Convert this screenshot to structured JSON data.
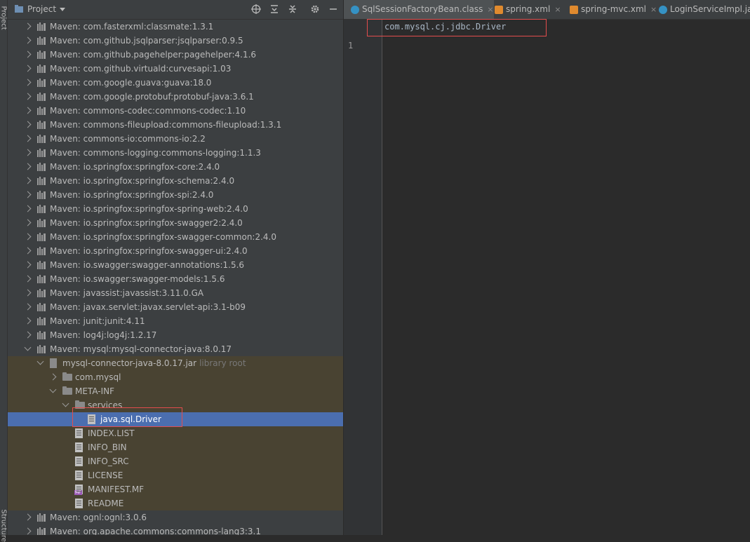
{
  "sidebar": {
    "project_label": "Project",
    "structure_label": "Structure"
  },
  "project_panel": {
    "title": "Project",
    "toolbar_icons": [
      "target-icon",
      "expand-all-icon",
      "collapse-all-icon",
      "gear-icon",
      "minimize-icon"
    ]
  },
  "tree": {
    "rows": [
      {
        "label": "Maven: com.fasterxml:classmate:1.3.1",
        "type": "lib",
        "chevron": "right"
      },
      {
        "label": "Maven: com.github.jsqlparser:jsqlparser:0.9.5",
        "type": "lib",
        "chevron": "right"
      },
      {
        "label": "Maven: com.github.pagehelper:pagehelper:4.1.6",
        "type": "lib",
        "chevron": "right"
      },
      {
        "label": "Maven: com.github.virtuald:curvesapi:1.03",
        "type": "lib",
        "chevron": "right"
      },
      {
        "label": "Maven: com.google.guava:guava:18.0",
        "type": "lib",
        "chevron": "right"
      },
      {
        "label": "Maven: com.google.protobuf:protobuf-java:3.6.1",
        "type": "lib",
        "chevron": "right"
      },
      {
        "label": "Maven: commons-codec:commons-codec:1.10",
        "type": "lib",
        "chevron": "right"
      },
      {
        "label": "Maven: commons-fileupload:commons-fileupload:1.3.1",
        "type": "lib",
        "chevron": "right"
      },
      {
        "label": "Maven: commons-io:commons-io:2.2",
        "type": "lib",
        "chevron": "right"
      },
      {
        "label": "Maven: commons-logging:commons-logging:1.1.3",
        "type": "lib",
        "chevron": "right"
      },
      {
        "label": "Maven: io.springfox:springfox-core:2.4.0",
        "type": "lib",
        "chevron": "right"
      },
      {
        "label": "Maven: io.springfox:springfox-schema:2.4.0",
        "type": "lib",
        "chevron": "right"
      },
      {
        "label": "Maven: io.springfox:springfox-spi:2.4.0",
        "type": "lib",
        "chevron": "right"
      },
      {
        "label": "Maven: io.springfox:springfox-spring-web:2.4.0",
        "type": "lib",
        "chevron": "right"
      },
      {
        "label": "Maven: io.springfox:springfox-swagger2:2.4.0",
        "type": "lib",
        "chevron": "right"
      },
      {
        "label": "Maven: io.springfox:springfox-swagger-common:2.4.0",
        "type": "lib",
        "chevron": "right"
      },
      {
        "label": "Maven: io.springfox:springfox-swagger-ui:2.4.0",
        "type": "lib",
        "chevron": "right"
      },
      {
        "label": "Maven: io.swagger:swagger-annotations:1.5.6",
        "type": "lib",
        "chevron": "right"
      },
      {
        "label": "Maven: io.swagger:swagger-models:1.5.6",
        "type": "lib",
        "chevron": "right"
      },
      {
        "label": "Maven: javassist:javassist:3.11.0.GA",
        "type": "lib",
        "chevron": "right"
      },
      {
        "label": "Maven: javax.servlet:javax.servlet-api:3.1-b09",
        "type": "lib",
        "chevron": "right"
      },
      {
        "label": "Maven: junit:junit:4.11",
        "type": "lib",
        "chevron": "right"
      },
      {
        "label": "Maven: log4j:log4j:1.2.17",
        "type": "lib",
        "chevron": "right"
      },
      {
        "label": "Maven: mysql:mysql-connector-java:8.0.17",
        "type": "lib",
        "chevron": "down"
      },
      {
        "label": "mysql-connector-java-8.0.17.jar",
        "hint": "library root",
        "type": "jar",
        "chevron": "down"
      },
      {
        "label": "com.mysql",
        "type": "folder",
        "chevron": "right"
      },
      {
        "label": "META-INF",
        "type": "folder",
        "chevron": "down"
      },
      {
        "label": "services",
        "type": "folder",
        "chevron": "down"
      },
      {
        "label": "java.sql.Driver",
        "type": "file",
        "chevron": "none"
      },
      {
        "label": "INDEX.LIST",
        "type": "file",
        "chevron": "none"
      },
      {
        "label": "INFO_BIN",
        "type": "file",
        "chevron": "none"
      },
      {
        "label": "INFO_SRC",
        "type": "file",
        "chevron": "none"
      },
      {
        "label": "LICENSE",
        "type": "file",
        "chevron": "none"
      },
      {
        "label": "MANIFEST.MF",
        "type": "mf",
        "chevron": "none"
      },
      {
        "label": "README",
        "type": "file",
        "chevron": "none"
      },
      {
        "label": "Maven: ognl:ognl:3.0.6",
        "type": "lib",
        "chevron": "right"
      },
      {
        "label": "Maven: org.apache.commons:commons-lang3:3.1",
        "type": "lib",
        "chevron": "right"
      }
    ]
  },
  "editor": {
    "tabs": [
      {
        "label": "SqlSessionFactoryBean.class",
        "icon": "class",
        "closable": true,
        "active": true
      },
      {
        "label": "spring.xml",
        "icon": "xml",
        "closable": true,
        "active": false
      },
      {
        "label": "spring-mvc.xml",
        "icon": "xml",
        "closable": true,
        "active": false
      },
      {
        "label": "LoginServiceImpl.java",
        "icon": "class",
        "closable": false,
        "active": false
      }
    ],
    "line_number": "1",
    "code": "com.mysql.cj.jdbc.Driver"
  },
  "colors": {
    "selection": "#4b6eaf",
    "expanded_bg": "#494332",
    "highlight_box": "#e34d4d"
  }
}
